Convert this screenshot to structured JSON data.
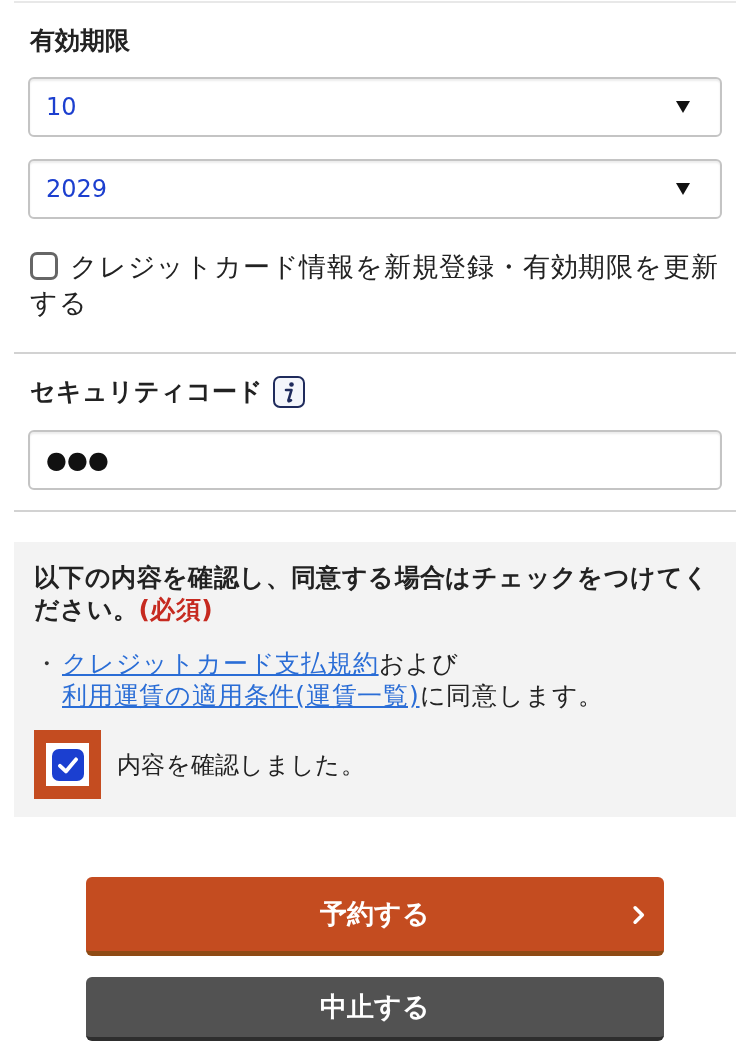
{
  "expiry": {
    "label": "有効期限",
    "selects": [
      {
        "value": "10"
      },
      {
        "value": "2029"
      }
    ],
    "register_card": {
      "label": "クレジットカード情報を新規登録・有効期限を更新する",
      "checked": false
    }
  },
  "security_code": {
    "label": "セキュリティコード",
    "value": "●●●"
  },
  "agreement": {
    "instruction": "以下の内容を確認し、同意する場合はチェックをつけてください。",
    "required_mark": "(必須)",
    "terms": {
      "bullet": "・",
      "parts": [
        {
          "kind": "link",
          "text": "クレジットカード支払規約"
        },
        {
          "kind": "text",
          "text": "および"
        },
        {
          "kind": "link",
          "text": "利用運賃の適用条件(運賃一覧)"
        },
        {
          "kind": "text",
          "text": "に同意します。"
        }
      ]
    },
    "confirm": {
      "label": "内容を確認しました。",
      "checked": true
    }
  },
  "buttons": [
    {
      "kind": "primary",
      "label": "予約する"
    },
    {
      "kind": "secondary",
      "label": "中止する"
    }
  ]
}
